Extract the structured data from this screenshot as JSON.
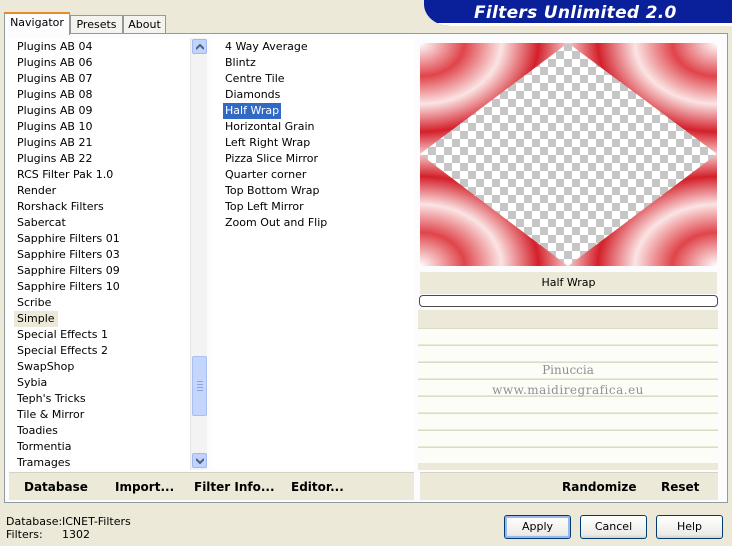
{
  "tabs": [
    "Navigator",
    "Presets",
    "About"
  ],
  "brand_title": "Filters Unlimited 2.0",
  "categories": [
    "Plugins AB 04",
    "Plugins AB 06",
    "Plugins AB 07",
    "Plugins AB 08",
    "Plugins AB 09",
    "Plugins AB 10",
    "Plugins AB 21",
    "Plugins AB 22",
    "RCS Filter Pak 1.0",
    "Render",
    "Rorshack Filters",
    "Sabercat",
    "Sapphire Filters 01",
    "Sapphire Filters 03",
    "Sapphire Filters 09",
    "Sapphire Filters 10",
    "Scribe",
    "Simple",
    "Special Effects 1",
    "Special Effects 2",
    "SwapShop",
    "Sybia",
    "Teph's Tricks",
    "Tile & Mirror",
    "Toadies",
    "Tormentia",
    "Tramages"
  ],
  "selected_category": "Simple",
  "filters": [
    "4 Way Average",
    "Blintz",
    "Centre Tile",
    "Diamonds",
    "Half Wrap",
    "Horizontal Grain",
    "Left Right Wrap",
    "Pizza Slice Mirror",
    "Quarter corner",
    "Top Bottom Wrap",
    "Top Left Mirror",
    "Zoom Out and Flip"
  ],
  "selected_filter": "Half Wrap",
  "preview_filter_name": "Half Wrap",
  "watermark": {
    "line1": "Pinuccia",
    "line2": "www.maidiregrafica.eu"
  },
  "toolbar": {
    "database": "Database",
    "import": "Import...",
    "filter_info": "Filter Info...",
    "editor": "Editor...",
    "randomize": "Randomize",
    "reset": "Reset"
  },
  "status": {
    "database_label": "Database:",
    "database_value": "ICNET-Filters",
    "filters_label": "Filters:",
    "filters_value": "1302"
  },
  "buttons": {
    "apply": "Apply",
    "cancel": "Cancel",
    "help": "Help"
  },
  "colors": {
    "brand": "#0a1f9a",
    "selection": "#316ac5",
    "preview_red": "#d8232a"
  }
}
